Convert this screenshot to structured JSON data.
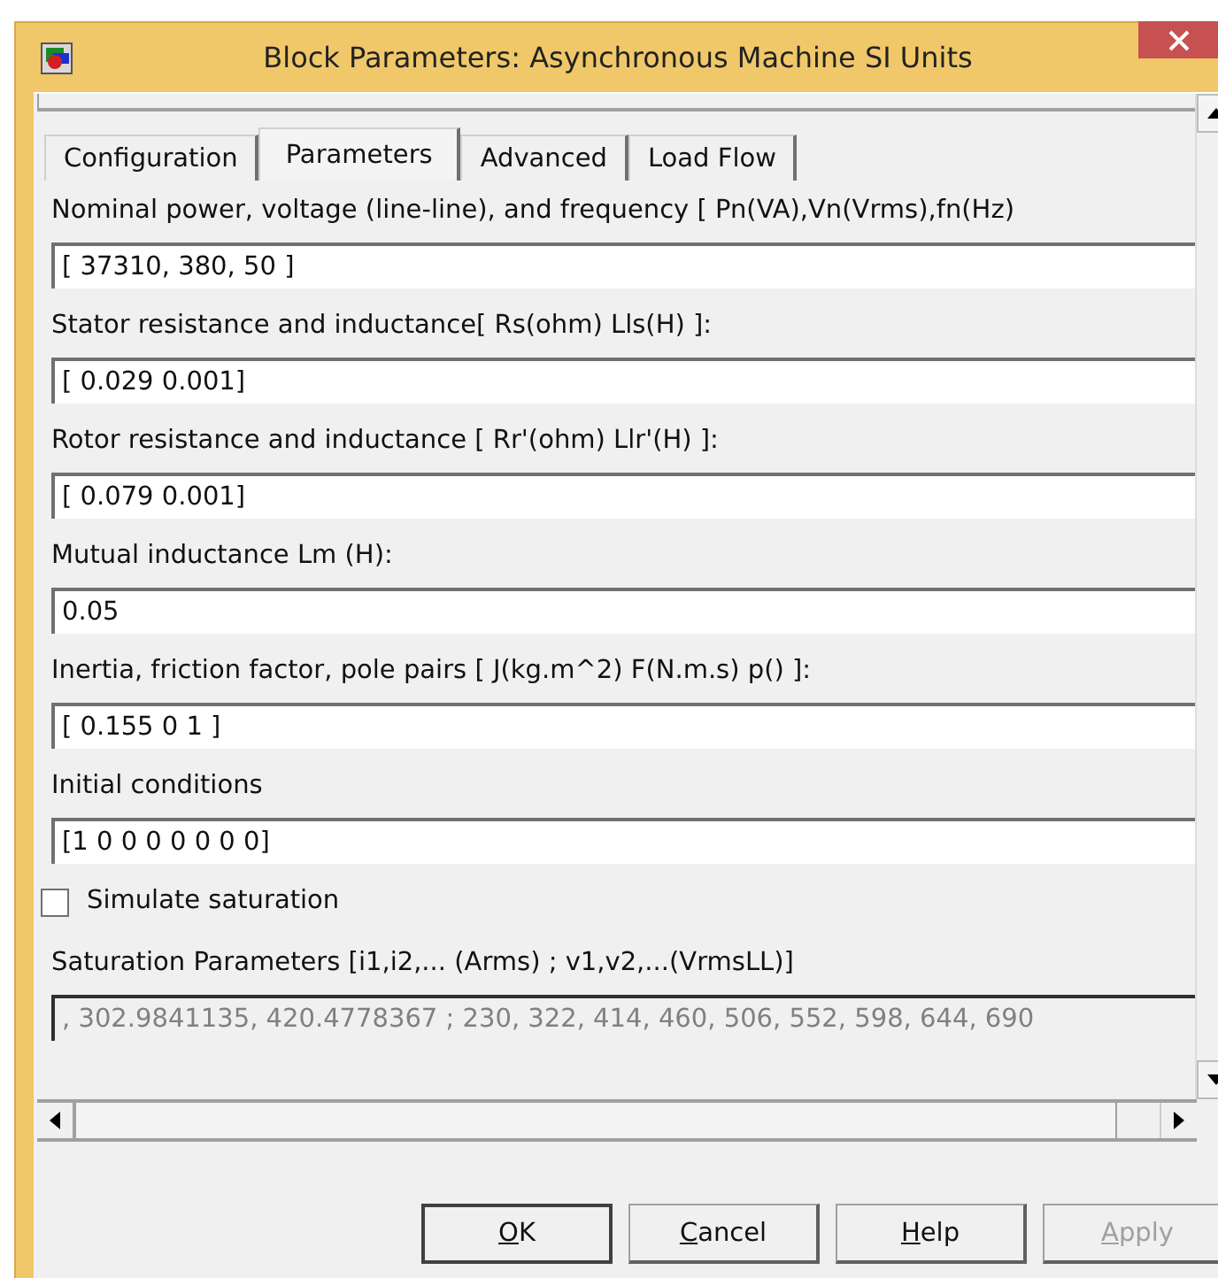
{
  "window": {
    "title": "Block Parameters: Asynchronous Machine SI Units"
  },
  "tabs": [
    {
      "label": "Configuration",
      "selected": false
    },
    {
      "label": "Parameters",
      "selected": true
    },
    {
      "label": "Advanced",
      "selected": false
    },
    {
      "label": "Load Flow",
      "selected": false
    }
  ],
  "parameters": [
    {
      "label": "Nominal power, voltage (line-line), and frequency [ Pn(VA),Vn(Vrms),fn(Hz)",
      "value": "[ 37310, 380, 50 ]"
    },
    {
      "label": "Stator resistance and inductance[ Rs(ohm)  Lls(H) ]:",
      "value": "[ 0.029 0.001]"
    },
    {
      "label": "Rotor resistance and inductance [ Rr'(ohm)  Llr'(H) ]:",
      "value": "[ 0.079 0.001]"
    },
    {
      "label": "Mutual inductance Lm (H):",
      "value": "0.05"
    },
    {
      "label": "Inertia, friction factor, pole pairs [ J(kg.m^2)  F(N.m.s)   p() ]:",
      "value": "[ 0.155 0  1 ]"
    },
    {
      "label": "Initial conditions",
      "value": "[1 0 0 0 0 0 0 0]"
    }
  ],
  "simulate_saturation": {
    "label": "Simulate saturation",
    "checked": false
  },
  "saturation": {
    "label": "Saturation Parameters [i1,i2,... (Arms) ; v1,v2,...(VrmsLL)]",
    "value": ", 302.9841135, 420.4778367 ; 230, 322, 414, 460, 506, 552, 598, 644, 690",
    "disabled": true
  },
  "buttons": [
    {
      "label": "OK",
      "disabled": false
    },
    {
      "label": "Cancel",
      "disabled": false
    },
    {
      "label": "Help",
      "disabled": false
    },
    {
      "label": "Apply",
      "disabled": true
    }
  ]
}
